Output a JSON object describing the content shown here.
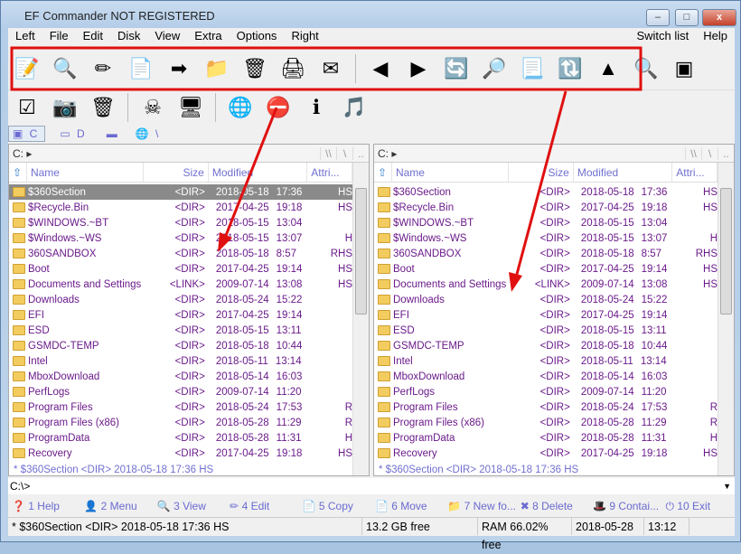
{
  "window": {
    "title": "EF Commander NOT REGISTERED",
    "minimize": "–",
    "maximize": "□",
    "close": "x"
  },
  "menu": [
    "Left",
    "File",
    "Edit",
    "Disk",
    "View",
    "Extra",
    "Options",
    "Right"
  ],
  "menu_right": [
    "Switch list",
    "Help"
  ],
  "toolbar1": [
    "📝",
    "🔍",
    "✏",
    "📄",
    "➡",
    "📁",
    "🗑",
    "🖨",
    "✉",
    "◀",
    "▶",
    "🔄",
    "🔎",
    "📃",
    "🔃",
    "▲",
    "🔍",
    "▣"
  ],
  "toolbar2": [
    "☑",
    "📷",
    "🗑",
    "☠",
    "🖥",
    "🌐",
    "⛔",
    "ℹ",
    "🎵"
  ],
  "drives": [
    "C",
    "D",
    "",
    ""
  ],
  "drive_net": "\\",
  "path": "C: ▸",
  "path_buttons": [
    "\\\\",
    "\\",
    ".."
  ],
  "columns": {
    "name": "Name",
    "size": "Size",
    "modified": "Modified",
    "attr": "Attri..."
  },
  "files": [
    {
      "name": "$360Section",
      "size": "<DIR>",
      "date": "2018-05-18",
      "time": "17:36",
      "attr": "HS"
    },
    {
      "name": "$Recycle.Bin",
      "size": "<DIR>",
      "date": "2017-04-25",
      "time": "19:18",
      "attr": "HS"
    },
    {
      "name": "$WINDOWS.~BT",
      "size": "<DIR>",
      "date": "2018-05-15",
      "time": "13:04",
      "attr": ""
    },
    {
      "name": "$Windows.~WS",
      "size": "<DIR>",
      "date": "2018-05-15",
      "time": "13:07",
      "attr": "H"
    },
    {
      "name": "360SANDBOX",
      "size": "<DIR>",
      "date": "2018-05-18",
      "time": "8:57",
      "attr": "RHS"
    },
    {
      "name": "Boot",
      "size": "<DIR>",
      "date": "2017-04-25",
      "time": "19:14",
      "attr": "HS"
    },
    {
      "name": "Documents and Settings",
      "size": "<LINK>",
      "date": "2009-07-14",
      "time": "13:08",
      "attr": "HS"
    },
    {
      "name": "Downloads",
      "size": "<DIR>",
      "date": "2018-05-24",
      "time": "15:22",
      "attr": ""
    },
    {
      "name": "EFI",
      "size": "<DIR>",
      "date": "2017-04-25",
      "time": "19:14",
      "attr": ""
    },
    {
      "name": "ESD",
      "size": "<DIR>",
      "date": "2018-05-15",
      "time": "13:11",
      "attr": ""
    },
    {
      "name": "GSMDC-TEMP",
      "size": "<DIR>",
      "date": "2018-05-18",
      "time": "10:44",
      "attr": ""
    },
    {
      "name": "Intel",
      "size": "<DIR>",
      "date": "2018-05-11",
      "time": "13:14",
      "attr": ""
    },
    {
      "name": "MboxDownload",
      "size": "<DIR>",
      "date": "2018-05-14",
      "time": "16:03",
      "attr": ""
    },
    {
      "name": "PerfLogs",
      "size": "<DIR>",
      "date": "2009-07-14",
      "time": "11:20",
      "attr": ""
    },
    {
      "name": "Program Files",
      "size": "<DIR>",
      "date": "2018-05-24",
      "time": "17:53",
      "attr": "R"
    },
    {
      "name": "Program Files (x86)",
      "size": "<DIR>",
      "date": "2018-05-28",
      "time": "11:29",
      "attr": "R"
    },
    {
      "name": "ProgramData",
      "size": "<DIR>",
      "date": "2018-05-28",
      "time": "11:31",
      "attr": "H"
    },
    {
      "name": "Recovery",
      "size": "<DIR>",
      "date": "2017-04-25",
      "time": "19:18",
      "attr": "HS"
    }
  ],
  "panel_status": "* $360Section    <DIR>  2018-05-18   17:36  HS",
  "command_line": "C:\\>",
  "fkeys": [
    "1 Help",
    "2 Menu",
    "3 View",
    "4 Edit",
    "5 Copy",
    "6 Move",
    "7 New fo...",
    "8 Delete",
    "9 Contai...",
    "10 Exit"
  ],
  "status": {
    "selected": "* $360Section     <DIR>   2018-05-18  17:36  HS",
    "free": "13.2 GB free",
    "ram": "RAM 66.02% free",
    "date": "2018-05-28",
    "time": "13:12"
  },
  "colors": {
    "annotation": "#e01010",
    "file_text": "#6a1a8a",
    "selection": "#8a8a8a"
  }
}
